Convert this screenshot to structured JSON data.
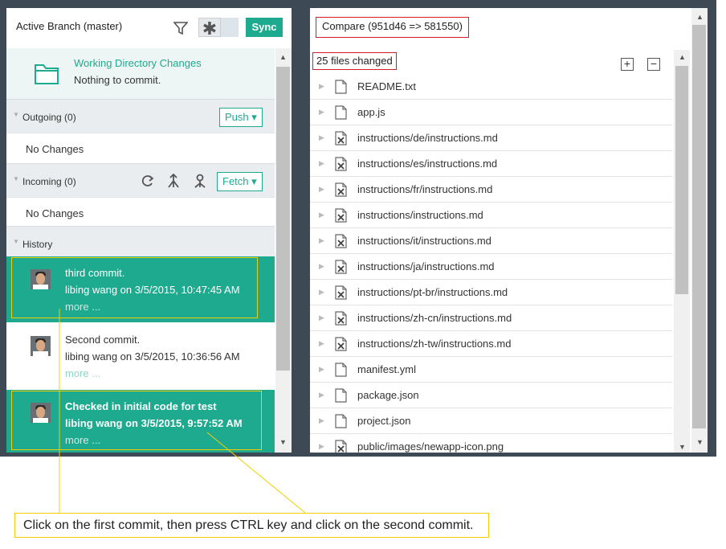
{
  "left": {
    "branch_title": "Active Branch (master)",
    "sync_label": "Sync",
    "star_glyph": "✱",
    "working_dir": {
      "title": "Working Directory Changes",
      "subtitle": "Nothing to commit."
    },
    "outgoing": {
      "label": "Outgoing (0)",
      "button": "Push ▾",
      "empty": "No Changes"
    },
    "incoming": {
      "label": "Incoming (0)",
      "button": "Fetch ▾",
      "empty": "No Changes"
    },
    "history": {
      "label": "History"
    },
    "commits": [
      {
        "message": "third commit.",
        "meta": "libing wang on 3/5/2015, 10:47:45 AM",
        "more": "more ...",
        "selected": true
      },
      {
        "message": "Second commit.",
        "meta": "libing wang on 3/5/2015, 10:36:56 AM",
        "more": "more ...",
        "selected": false
      },
      {
        "message": "Checked in initial code for test",
        "meta": "libing wang on 3/5/2015, 9:57:52 AM",
        "more": "more ...",
        "selected": true
      }
    ]
  },
  "right": {
    "compare_title": "Compare (951d46 => 581550)",
    "files_changed": "25 files changed",
    "expand_glyph": "+",
    "collapse_glyph": "−",
    "files": [
      {
        "name": "README.txt",
        "icon": "file-icon"
      },
      {
        "name": "app.js",
        "icon": "file-icon"
      },
      {
        "name": "instructions/de/instructions.md",
        "icon": "file-deleted-icon"
      },
      {
        "name": "instructions/es/instructions.md",
        "icon": "file-deleted-icon"
      },
      {
        "name": "instructions/fr/instructions.md",
        "icon": "file-deleted-icon"
      },
      {
        "name": "instructions/instructions.md",
        "icon": "file-deleted-icon"
      },
      {
        "name": "instructions/it/instructions.md",
        "icon": "file-deleted-icon"
      },
      {
        "name": "instructions/ja/instructions.md",
        "icon": "file-deleted-icon"
      },
      {
        "name": "instructions/pt-br/instructions.md",
        "icon": "file-deleted-icon"
      },
      {
        "name": "instructions/zh-cn/instructions.md",
        "icon": "file-deleted-icon"
      },
      {
        "name": "instructions/zh-tw/instructions.md",
        "icon": "file-deleted-icon"
      },
      {
        "name": "manifest.yml",
        "icon": "file-icon"
      },
      {
        "name": "package.json",
        "icon": "file-icon"
      },
      {
        "name": "project.json",
        "icon": "file-icon"
      },
      {
        "name": "public/images/newapp-icon.png",
        "icon": "file-deleted-icon"
      }
    ]
  },
  "annotation": {
    "text": "Click on the first commit, then press CTRL key and click on the second commit."
  },
  "colors": {
    "accent": "#1daa8f",
    "frame": "#3d4a56",
    "highlight_red": "#d2202a",
    "callout_yellow": "#f0d000"
  }
}
